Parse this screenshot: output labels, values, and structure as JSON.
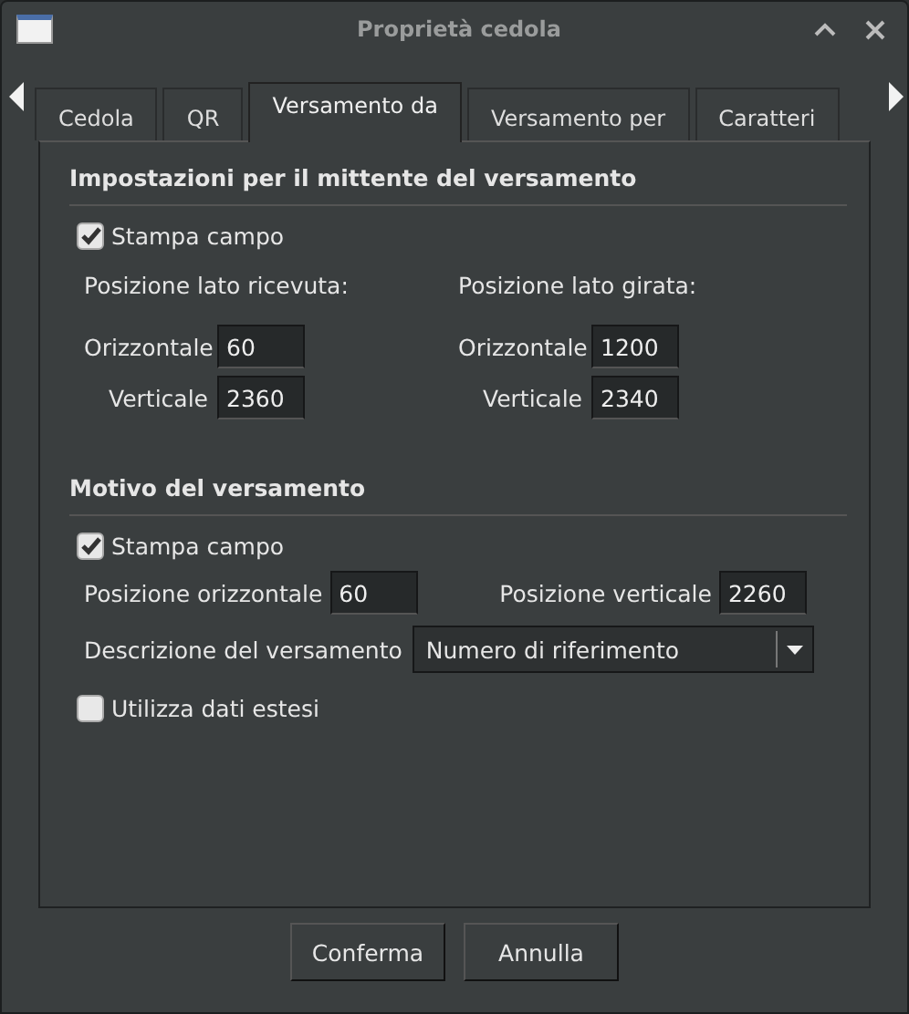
{
  "window": {
    "title": "Proprietà cedola"
  },
  "tabs": [
    {
      "label": "Cedola",
      "selected": false
    },
    {
      "label": "QR",
      "selected": false
    },
    {
      "label": "Versamento da",
      "selected": true
    },
    {
      "label": "Versamento per",
      "selected": false
    },
    {
      "label": "Caratteri",
      "selected": false
    }
  ],
  "sender": {
    "heading": "Impostazioni per il mittente del versamento",
    "print_field": {
      "label": "Stampa campo",
      "checked": true
    },
    "columns": [
      {
        "title": "Posizione lato ricevuta:",
        "fields": [
          {
            "label": "Orizzontale",
            "value": "60"
          },
          {
            "label": "Verticale",
            "value": "2360"
          }
        ]
      },
      {
        "title": "Posizione lato girata:",
        "fields": [
          {
            "label": "Orizzontale",
            "value": "1200"
          },
          {
            "label": "Verticale",
            "value": "2340"
          }
        ]
      }
    ]
  },
  "reason": {
    "heading": "Motivo del versamento",
    "print_field": {
      "label": "Stampa campo",
      "checked": true
    },
    "fields": [
      {
        "label": "Posizione orizzontale",
        "value": "60"
      },
      {
        "label": "Posizione verticale",
        "value": "2260"
      }
    ],
    "description": {
      "label": "Descrizione del versamento",
      "value": "Numero di riferimento"
    },
    "extended": {
      "label": "Utilizza dati estesi",
      "checked": false
    }
  },
  "buttons": [
    "Conferma",
    "Annulla"
  ]
}
